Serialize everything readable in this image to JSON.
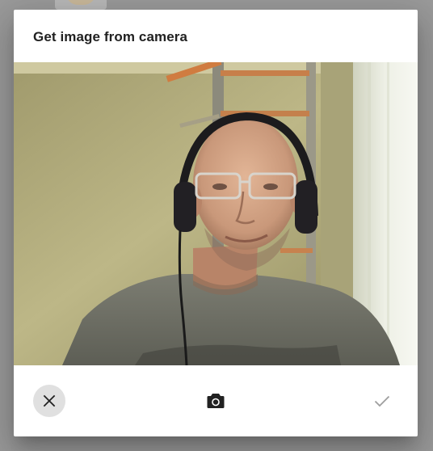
{
  "dialog": {
    "title": "Get image from camera"
  },
  "preview": {
    "content": "live webcam feed"
  },
  "actions": {
    "cancel_icon": "close-icon",
    "capture_icon": "camera-icon",
    "confirm_icon": "check-icon",
    "cancel_bg": "#e0e0e0",
    "icon_color": "#212121",
    "confirm_color": "#9e9e9e"
  }
}
